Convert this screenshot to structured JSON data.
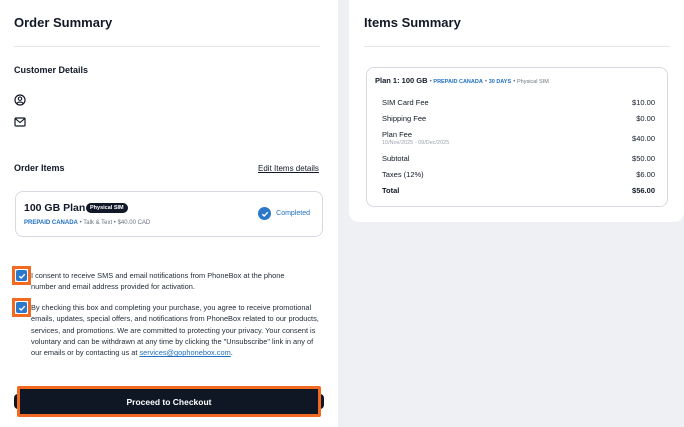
{
  "order_summary": {
    "title": "Order Summary",
    "customer_details_label": "Customer Details",
    "order_items_label": "Order Items",
    "edit_items_link": "Edit Items details",
    "item": {
      "name": "100 GB Plan",
      "badge": "Physical SIM",
      "provider": "PREPAID CANADA",
      "details": " • Talk & Text • $40.00 CAD",
      "status": "Completed"
    },
    "consent_sms": {
      "checked": true,
      "text": "I consent to receive SMS and email notifications from PhoneBox at the phone number and email address provided for activation."
    },
    "consent_marketing": {
      "checked": true,
      "text": "By checking this box and completing your purchase, you agree to receive promotional emails, updates, special offers, and notifications from PhoneBox related to our products, services, and promotions. We are committed to protecting your privacy. Your consent is voluntary and can be withdrawn at any time by clicking the \"Unsubscribe\" link in any of our emails or by contacting us at ",
      "email": "services@gophonebox.com",
      "text_end": "."
    },
    "checkout_button": "Proceed to Checkout"
  },
  "items_summary": {
    "title": "Items Summary",
    "plan_title": "Plan 1: 100 GB",
    "plan_provider": "PREPAID CANADA",
    "plan_days": "30 DAYS",
    "plan_sim": "Physical SIM",
    "rows": [
      {
        "label": "SIM Card Fee",
        "value": "$10.00"
      },
      {
        "label": "Shipping Fee",
        "value": "$0.00"
      },
      {
        "label": "Plan Fee",
        "sub": "10/Nov/2025 - 09/Dec/2025",
        "value": "$40.00"
      },
      {
        "label": "Subtotal",
        "value": "$50.00"
      },
      {
        "label": "Taxes (12%)",
        "value": "$6.00"
      },
      {
        "label": "Total",
        "value": "$56.00"
      }
    ]
  },
  "colors": {
    "accent_blue": "#2b77c9",
    "highlight_orange": "#f26a21",
    "button_dark": "#0f1724"
  },
  "icons": [
    "user-circle-icon",
    "mail-icon",
    "check-circle-icon",
    "checkbox-check-icon"
  ]
}
